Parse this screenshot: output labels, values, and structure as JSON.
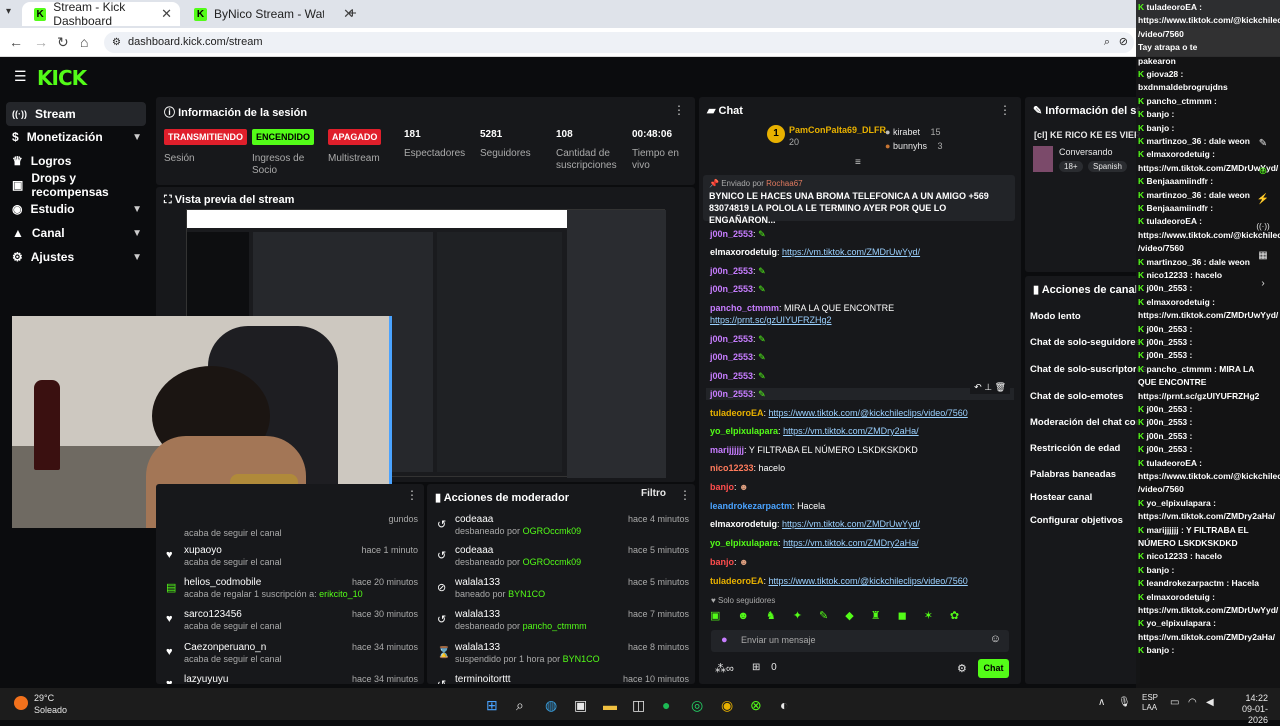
{
  "browser": {
    "tabs": [
      {
        "title": "Stream - Kick Dashboard"
      },
      {
        "title": "ByNico Stream - Watch Live on"
      }
    ],
    "url": "dashboard.kick.com/stream"
  },
  "brand": {
    "logo": "KICK",
    "accent": "#53fc18"
  },
  "sidebar": {
    "items": [
      {
        "label": "Stream"
      },
      {
        "label": "Monetización"
      },
      {
        "label": "Logros"
      },
      {
        "label": "Drops y recompensas"
      },
      {
        "label": "Estudio"
      },
      {
        "label": "Canal"
      },
      {
        "label": "Ajustes"
      }
    ]
  },
  "session": {
    "title": "Información de la sesión",
    "stats": [
      {
        "badge": "TRANSMITIENDO",
        "label": "Sesión"
      },
      {
        "badge": "ENCENDIDO",
        "label": "Ingresos de Socio"
      },
      {
        "badge": "APAGADO",
        "label": "Multistream"
      },
      {
        "value": "181",
        "label": "Espectadores"
      },
      {
        "value": "5281",
        "label": "Seguidores"
      },
      {
        "value": "108",
        "label": "Cantidad de suscripciones"
      },
      {
        "value": "00:48:06",
        "label": "Tiempo en vivo"
      }
    ]
  },
  "preview": {
    "title": "Vista previa del stream"
  },
  "events": [
    {
      "name": "",
      "desc": "acaba de seguir el canal",
      "time": "gundos"
    },
    {
      "name": "xupaoyo",
      "desc": "acaba de seguir el canal",
      "time": "hace 1 minuto"
    },
    {
      "name": "helios_codmobile",
      "desc": "acaba de regalar 1 suscripción a:",
      "target": "erikcito_10",
      "time": "hace 20 minutos"
    },
    {
      "name": "sarco123456",
      "desc": "acaba de seguir el canal",
      "time": "hace 30 minutos"
    },
    {
      "name": "Caezonperuano_n",
      "desc": "acaba de seguir el canal",
      "time": "hace 34 minutos"
    },
    {
      "name": "lazyuyuyu",
      "desc": "",
      "time": "hace 34 minutos"
    }
  ],
  "modactions": {
    "title": "Acciones de moderador",
    "filter": "Filtro",
    "items": [
      {
        "user": "codeaaa",
        "action": "desbaneado por",
        "by": "OGROccmk09",
        "time": "hace 4 minutos"
      },
      {
        "user": "codeaaa",
        "action": "desbaneado por",
        "by": "OGROccmk09",
        "time": "hace 5 minutos"
      },
      {
        "user": "walala133",
        "action": "baneado por",
        "by": "BYN1CO",
        "time": "hace 5 minutos"
      },
      {
        "user": "walala133",
        "action": "desbaneado por",
        "by": "pancho_ctmmm",
        "time": "hace 7 minutos"
      },
      {
        "user": "walala133",
        "action": "suspendido por 1 hora por",
        "by": "BYN1CO",
        "time": "hace 8 minutos"
      },
      {
        "user": "terminoitorttt",
        "action": "",
        "by": "",
        "time": "hace 10 minutos"
      }
    ]
  },
  "chat": {
    "title": "Chat",
    "top": {
      "u1": "PamConPalta69_DLFR",
      "n1": "20",
      "u2": "kirabet",
      "n2": "15",
      "u3": "bunnyhs",
      "n3": "3"
    },
    "pinned": {
      "label": "Enviado por",
      "by": "Rochaa67",
      "text": "BYNICO LE HACES UNA BROMA TELEFONICA A UN AMIGO +569 83074819 LA POLOLA LE TERMINO AYER POR QUE LO ENGAÑARON..."
    },
    "messages": [
      {
        "user": "j00n_2553",
        "text": ""
      },
      {
        "user": "elmaxorodetuig",
        "text": "https://vm.tiktok.com/ZMDrUwYyd/"
      },
      {
        "user": "j00n_2553",
        "text": ""
      },
      {
        "user": "j00n_2553",
        "text": ""
      },
      {
        "user": "pancho_ctmmm",
        "text": "MIRA LA QUE ENCONTRE",
        "link": "https://prnt.sc/gzUIYUFRZHg2"
      },
      {
        "user": "j00n_2553",
        "text": ""
      },
      {
        "user": "j00n_2553",
        "text": ""
      },
      {
        "user": "j00n_2553",
        "text": ""
      },
      {
        "user": "j00n_2553",
        "text": ""
      },
      {
        "user": "tuladeoroEA",
        "text": "https://www.tiktok.com/@kickchileclips/video/7560"
      },
      {
        "user": "yo_elpixulapara",
        "text": "https://vm.tiktok.com/ZMDry2aHa/"
      },
      {
        "user": "marijjjjjj",
        "text": "Y FILTRABA EL NÚMERO LSKDKSKDKD"
      },
      {
        "user": "nico12233",
        "text": "hacelo"
      },
      {
        "user": "banjo",
        "text": ""
      },
      {
        "user": "leandrokezarpactm",
        "text": "Hacela"
      },
      {
        "user": "elmaxorodetuig",
        "text": "https://vm.tiktok.com/ZMDrUwYyd/"
      },
      {
        "user": "yo_elpixulapara",
        "text": "https://vm.tiktok.com/ZMDry2aHa/"
      },
      {
        "user": "banjo",
        "text": ""
      },
      {
        "user": "tuladeoroEA",
        "text": "https://www.tiktok.com/@kickchileclips/video/7560"
      }
    ],
    "mode": "Solo seguidores",
    "placeholder": "Enviar un mensaje",
    "points": "0",
    "send": "Chat"
  },
  "streaminfo": {
    "title": "Información del stream",
    "streamtitle": "[cl] KE RICO KE ES VIERNES :)",
    "category": "Conversando",
    "tags": [
      "18+",
      "Spanish"
    ]
  },
  "channelactions": {
    "title": "Acciones de canal",
    "items": [
      "Modo lento",
      "Chat de solo-seguidores",
      "Chat de solo-suscriptores",
      "Chat de solo-emotes",
      "Moderación del chat con IA",
      "Restricción de edad",
      "Palabras baneadas",
      "Hostear canal",
      "Configurar objetivos"
    ]
  },
  "overlay": [
    "tuladeoroEA :",
    "https://www.tiktok.com/@kickchileclips",
    "/video/7560",
    "Tay atrapa o te",
    "pakearon",
    "giova28 :",
    "bxdnmaldebrogrujdns",
    "pancho_ctmmm :",
    "banjo :",
    "banjo :",
    "martinzoo_36 : dale weon",
    "elmaxorodetuig :",
    "https://vm.tiktok.com/ZMDrUwYyd/",
    "Benjaaamiindfr :",
    "martinzoo_36 : dale weon",
    "Benjaaamiindfr :",
    "tuladeoroEA :",
    "https://www.tiktok.com/@kickchileclips",
    "/video/7560",
    "martinzoo_36 : dale weon",
    "nico12233 : hacelo",
    "j00n_2553 :",
    "elmaxorodetuig :",
    "https://vm.tiktok.com/ZMDrUwYyd/",
    "j00n_2553 :",
    "j00n_2553 :",
    "j00n_2553 :",
    "pancho_ctmmm : MIRA LA",
    "QUE ENCONTRE",
    "https://prnt.sc/gzUIYUFRZHg2",
    "j00n_2553 :",
    "j00n_2553 :",
    "j00n_2553 :",
    "j00n_2553 :",
    "tuladeoroEA :",
    "https://www.tiktok.com/@kickchileclips",
    "/video/7560",
    "yo_elpixulapara :",
    "https://vm.tiktok.com/ZMDry2aHa/",
    "marijjjjjj : Y FILTRABA EL",
    "NÚMERO LSKDKSKDKD",
    "nico12233 : hacelo",
    "banjo :",
    "leandrokezarpactm : Hacela",
    "elmaxorodetuig :",
    "https://vm.tiktok.com/ZMDrUwYyd/",
    "yo_elpixulapara :",
    "https://vm.tiktok.com/ZMDry2aHa/",
    "banjo :"
  ],
  "weather": {
    "temp": "29°C",
    "desc": "Soleado"
  },
  "clock": {
    "lang": "ESP",
    "region": "LAA",
    "time": "14:22",
    "date": "09-01-2026"
  }
}
